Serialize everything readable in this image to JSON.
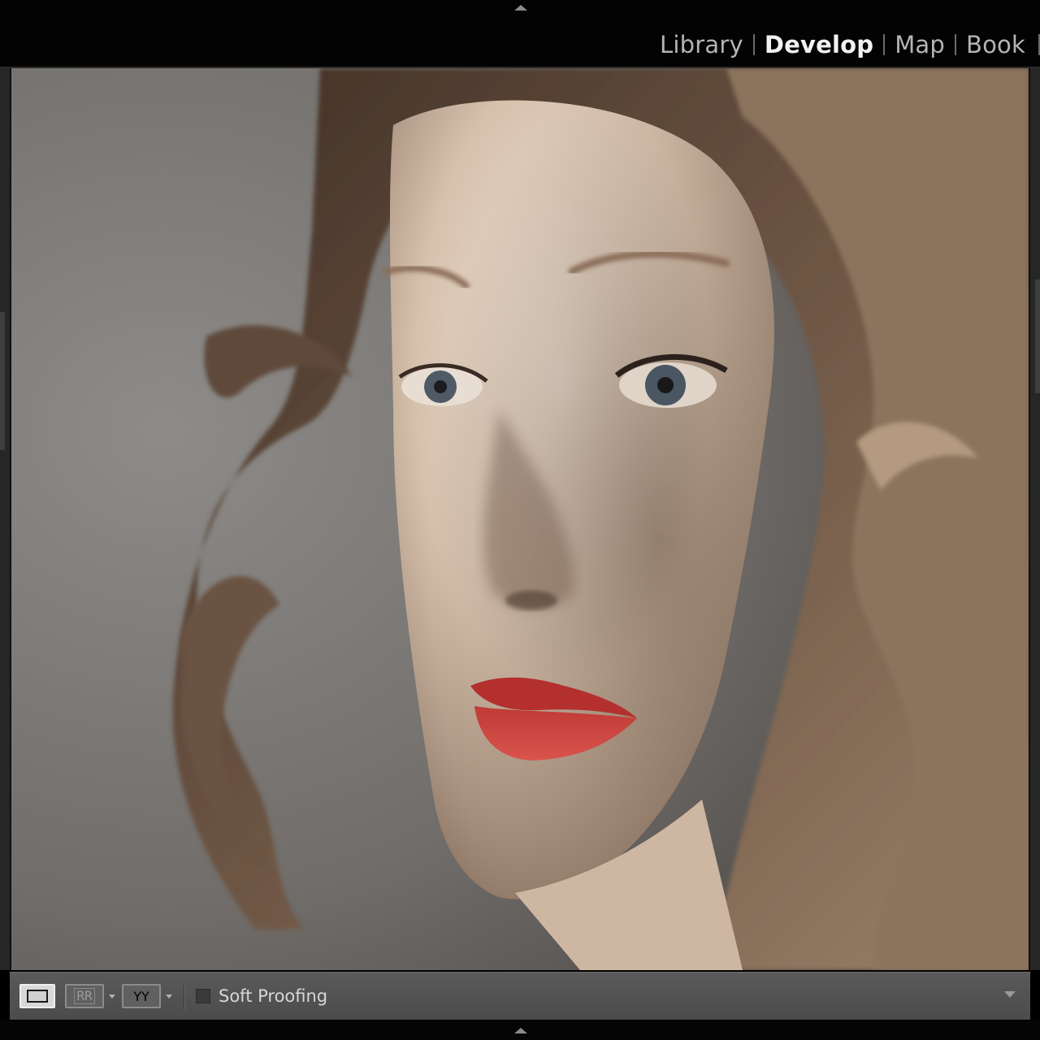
{
  "modules": {
    "items": [
      {
        "label": "Library",
        "active": false
      },
      {
        "label": "Develop",
        "active": true
      },
      {
        "label": "Map",
        "active": false
      },
      {
        "label": "Book",
        "active": false
      }
    ]
  },
  "toolbar": {
    "loupe_icon": "loupe-view-icon",
    "compare_icon": "before-after-compare-icon",
    "compare_glyph": "RR",
    "survey_icon": "before-after-survey-icon",
    "survey_glyph": "YY",
    "soft_proofing_label": "Soft Proofing",
    "soft_proofing_checked": false
  },
  "photo": {
    "subject": "portrait"
  },
  "colors": {
    "active_module": "#f2f2f2",
    "inactive_module": "#b4b4b4",
    "toolbar": "#545454",
    "background": "#000000"
  }
}
